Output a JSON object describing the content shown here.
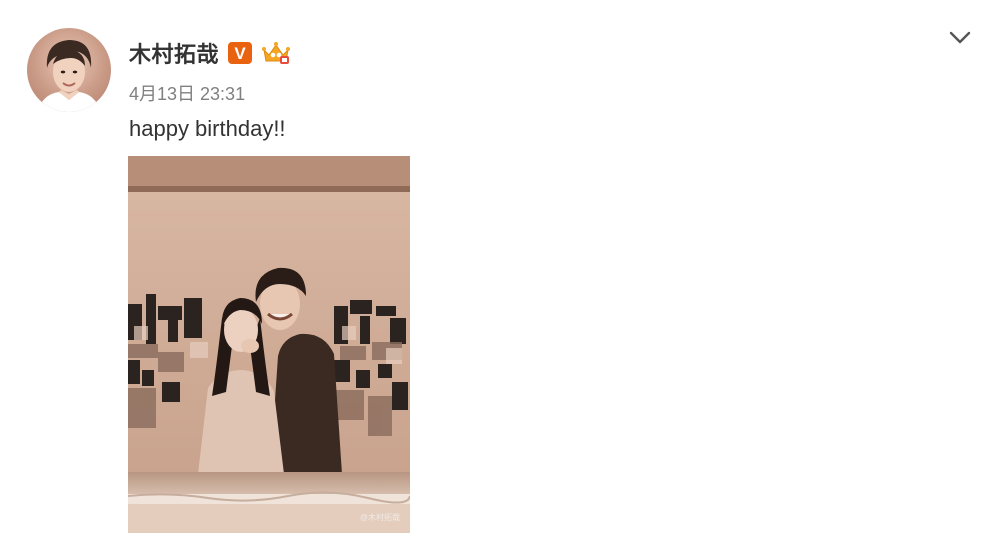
{
  "post": {
    "author": {
      "name": "木村拓哉",
      "verified_badge_letter": "V",
      "verified_color": "#e8620f",
      "crown_color": "#f5a623"
    },
    "timestamp": "4月13日 23:31",
    "text": "happy birthday!!",
    "photo": {
      "watermark": "@木村拓哉"
    },
    "icons": {
      "more": "chevron-down-icon"
    }
  }
}
